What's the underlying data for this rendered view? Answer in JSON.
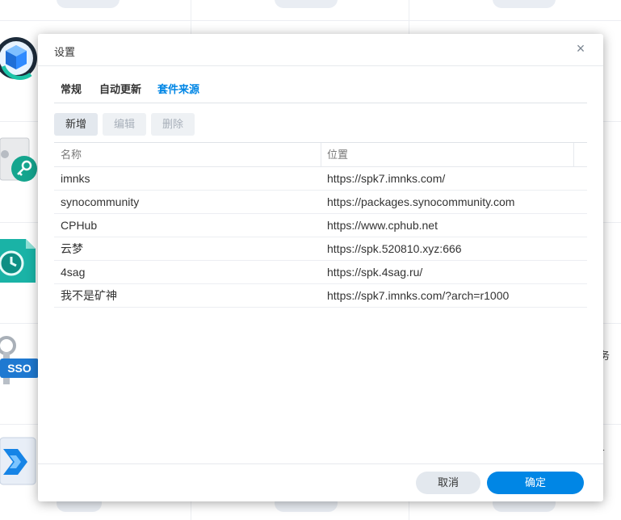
{
  "background": {
    "side_text_right": "务",
    "side_text_right2": "r"
  },
  "dialog": {
    "title": "设置",
    "close_glyph": "×",
    "tabs": [
      {
        "label": "常规"
      },
      {
        "label": "自动更新"
      },
      {
        "label": "套件来源",
        "active": true
      }
    ],
    "toolbar": {
      "add_label": "新增",
      "edit_label": "编辑",
      "delete_label": "删除"
    },
    "grid": {
      "columns": [
        "名称",
        "位置"
      ],
      "rows": [
        {
          "name": "imnks",
          "location": "https://spk7.imnks.com/"
        },
        {
          "name": "synocommunity",
          "location": "https://packages.synocommunity.com"
        },
        {
          "name": "CPHub",
          "location": "https://www.cphub.net"
        },
        {
          "name": "云梦",
          "location": "https://spk.520810.xyz:666"
        },
        {
          "name": "4sag",
          "location": "https://spk.4sag.ru/"
        },
        {
          "name": "我不是矿神",
          "location": "https://spk7.imnks.com/?arch=r1000"
        }
      ]
    },
    "footer": {
      "cancel_label": "取消",
      "ok_label": "确定"
    }
  },
  "colors": {
    "accent": "#0086e5",
    "button_gray": "#e3e8ee"
  }
}
